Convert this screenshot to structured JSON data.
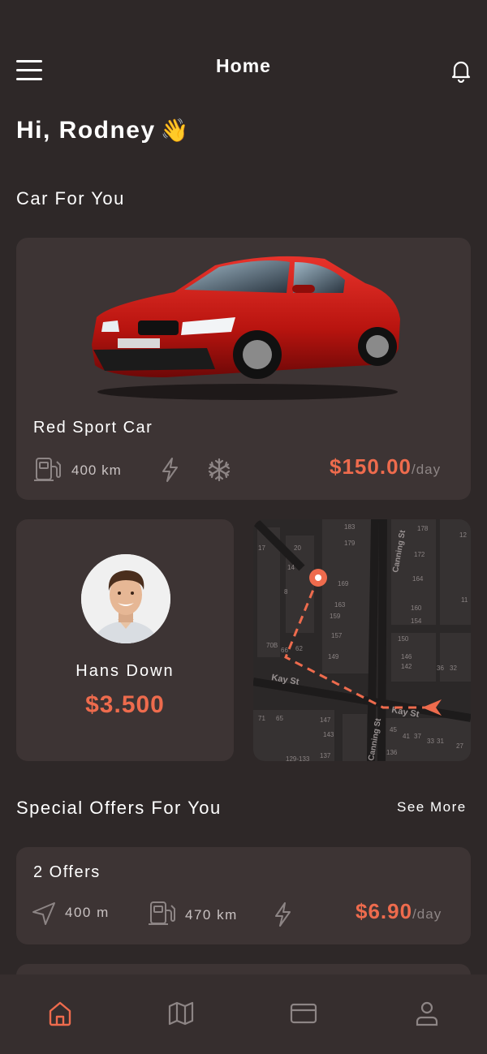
{
  "header": {
    "title": "Home"
  },
  "greeting": {
    "text": "Hi, Rodney",
    "emoji": "👋"
  },
  "car_section": {
    "title": "Car For You",
    "car": {
      "name": "Red Sport Car",
      "range": "400 km",
      "price": "$150.00",
      "per": "/day",
      "features": [
        "fuel-icon",
        "lightning-icon",
        "snowflake-icon"
      ]
    }
  },
  "driver": {
    "name": "Hans Down",
    "price": "$3.500"
  },
  "map": {
    "streets": [
      "Kay St",
      "Kay St",
      "Canning St",
      "Canning St"
    ],
    "numbers": [
      "183",
      "179",
      "178",
      "172",
      "169",
      "164",
      "163",
      "159",
      "160",
      "154",
      "157",
      "150",
      "149",
      "146",
      "142",
      "36",
      "32",
      "20",
      "14",
      "8",
      "70B",
      "66",
      "62",
      "71",
      "65",
      "147",
      "143",
      "137",
      "136",
      "45",
      "41",
      "37",
      "33",
      "31",
      "27",
      "129-133",
      "12",
      "11",
      "17"
    ]
  },
  "offers_section": {
    "title": "Special Offers For You",
    "see_more": "See More",
    "offer": {
      "title": "2 Offers",
      "distance": "400 m",
      "range": "470 km",
      "price": "$6.90",
      "per": "/day"
    }
  },
  "bottom_nav": {
    "items": [
      {
        "icon": "home-icon",
        "active": true
      },
      {
        "icon": "map-icon",
        "active": false
      },
      {
        "icon": "card-icon",
        "active": false
      },
      {
        "icon": "profile-icon",
        "active": false
      }
    ]
  },
  "colors": {
    "accent": "#ee6b4d",
    "background": "#2e2828",
    "card": "#3d3434"
  }
}
